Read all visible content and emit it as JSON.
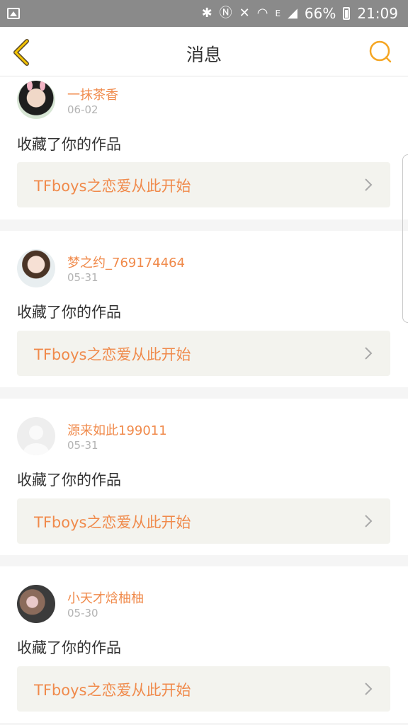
{
  "status_bar": {
    "battery": "66%",
    "time": "21:09",
    "signal_label": "E"
  },
  "header": {
    "title": "消息",
    "accent_color": "#f5a623"
  },
  "colors": {
    "username": "#f08a4b",
    "accent": "#f5a623"
  },
  "messages": [
    {
      "username": "一抹茶香",
      "date": "06-02",
      "action": "收藏了你的作品",
      "work_title": "TFboys之恋爱从此开始"
    },
    {
      "username": "梦之约_769174464",
      "date": "05-31",
      "action": "收藏了你的作品",
      "work_title": "TFboys之恋爱从此开始"
    },
    {
      "username": "源来如此199011",
      "date": "05-31",
      "action": "收藏了你的作品",
      "work_title": "TFboys之恋爱从此开始"
    },
    {
      "username": "小天才焓柚柚",
      "date": "05-30",
      "action": "收藏了你的作品",
      "work_title": "TFboys之恋爱从此开始"
    }
  ]
}
